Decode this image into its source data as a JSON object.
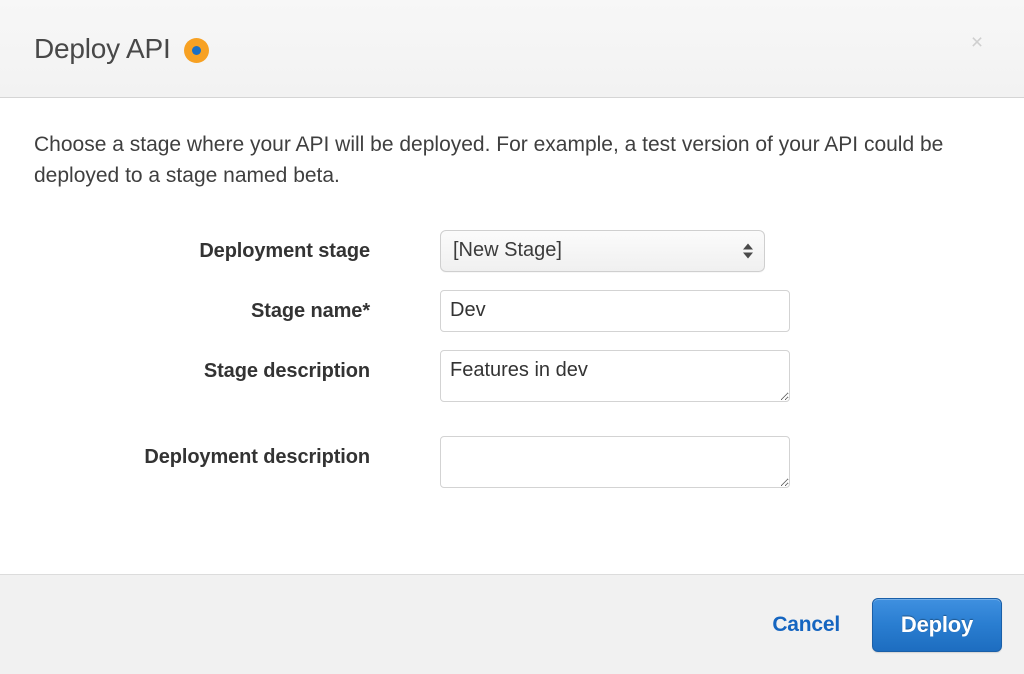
{
  "header": {
    "title": "Deploy API",
    "status_icon": "orange-dot-icon",
    "status_icon_outer_color": "#f7a123",
    "status_icon_inner_color": "#1a6fc4",
    "close_label": "×",
    "close_icon": "close-icon"
  },
  "body": {
    "intro": "Choose a stage where your API will be deployed. For example, a test version of your API could be deployed to a stage named beta."
  },
  "form": {
    "deployment_stage": {
      "label": "Deployment stage",
      "value": "[New Stage]",
      "options": [
        "[New Stage]"
      ],
      "stepper_icon": "up-down-stepper-icon"
    },
    "stage_name": {
      "label": "Stage name*",
      "value": "Dev",
      "placeholder": ""
    },
    "stage_description": {
      "label": "Stage description",
      "value": "Features in dev",
      "placeholder": ""
    },
    "deployment_description": {
      "label": "Deployment description",
      "value": "",
      "placeholder": ""
    }
  },
  "footer": {
    "cancel_label": "Cancel",
    "deploy_label": "Deploy",
    "cancel_color": "#1565c0",
    "deploy_color": "#2a7ed1"
  }
}
